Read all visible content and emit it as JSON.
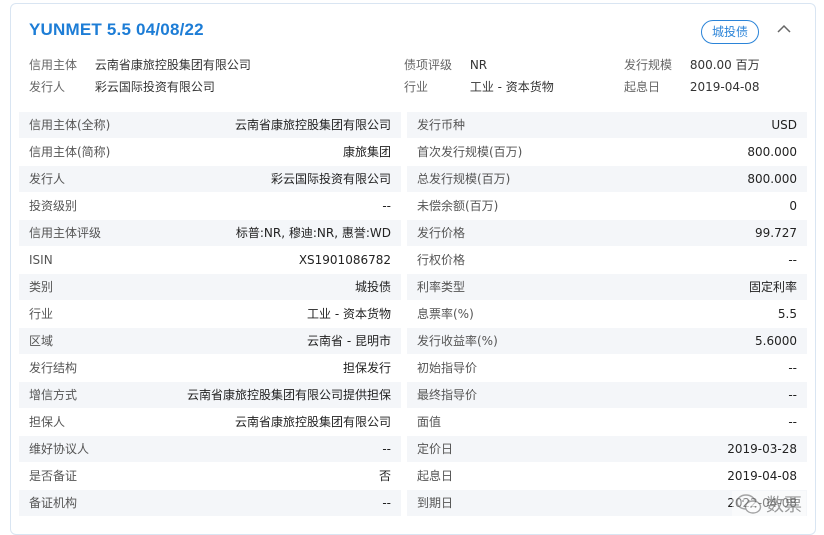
{
  "header": {
    "title": "YUNMET 5.5 04/08/22",
    "badge": "城投债"
  },
  "summary": [
    {
      "label": "信用主体",
      "value": "云南省康旅控股集团有限公司"
    },
    {
      "label": "发行人",
      "value": "彩云国际投资有限公司"
    },
    {
      "label": "债项评级",
      "value": "NR"
    },
    {
      "label": "行业",
      "value": "工业 - 资本货物"
    },
    {
      "label": "发行规模",
      "value": "800.00 百万"
    },
    {
      "label": "起息日",
      "value": "2019-04-08"
    }
  ],
  "details": [
    {
      "lk": "信用主体(全称)",
      "lv": "云南省康旅控股集团有限公司",
      "rk": "发行币种",
      "rv": "USD"
    },
    {
      "lk": "信用主体(简称)",
      "lv": "康旅集团",
      "rk": "首次发行规模(百万)",
      "rv": "800.000"
    },
    {
      "lk": "发行人",
      "lv": "彩云国际投资有限公司",
      "rk": "总发行规模(百万)",
      "rv": "800.000"
    },
    {
      "lk": "投资级别",
      "lv": "--",
      "rk": "未偿余额(百万)",
      "rv": "0"
    },
    {
      "lk": "信用主体评级",
      "lv": "标普:NR, 穆迪:NR, 惠誉:WD",
      "rk": "发行价格",
      "rv": "99.727"
    },
    {
      "lk": "ISIN",
      "lv": "XS1901086782",
      "rk": "行权价格",
      "rv": "--"
    },
    {
      "lk": "类别",
      "lv": "城投债",
      "rk": "利率类型",
      "rv": "固定利率"
    },
    {
      "lk": "行业",
      "lv": "工业 - 资本货物",
      "rk": "息票率(%)",
      "rv": "5.5"
    },
    {
      "lk": "区域",
      "lv": "云南省 - 昆明市",
      "rk": "发行收益率(%)",
      "rv": "5.6000"
    },
    {
      "lk": "发行结构",
      "lv": "担保发行",
      "rk": "初始指导价",
      "rv": "--"
    },
    {
      "lk": "增信方式",
      "lv": "云南省康旅控股集团有限公司提供担保",
      "rk": "最终指导价",
      "rv": "--"
    },
    {
      "lk": "担保人",
      "lv": "云南省康旅控股集团有限公司",
      "rk": "面值",
      "rv": "--"
    },
    {
      "lk": "维好协议人",
      "lv": "--",
      "rk": "定价日",
      "rv": "2019-03-28"
    },
    {
      "lk": "是否备证",
      "lv": "否",
      "rk": "起息日",
      "rv": "2019-04-08"
    },
    {
      "lk": "备证机构",
      "lv": "--",
      "rk": "到期日",
      "rv": "2022-04-08"
    }
  ],
  "watermark": {
    "text": "数票",
    "icon": "wechat-icon"
  },
  "colors": {
    "accent": "#1d7dd6",
    "stripe": "#f4f6f9",
    "border": "#d9e5f2"
  }
}
